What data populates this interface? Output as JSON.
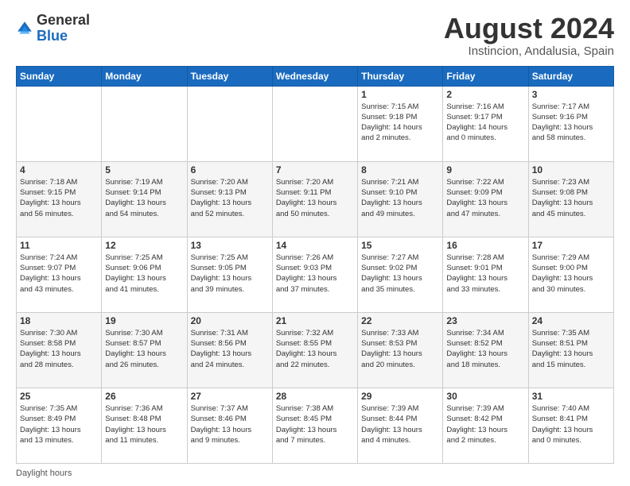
{
  "logo": {
    "general": "General",
    "blue": "Blue"
  },
  "header": {
    "title": "August 2024",
    "subtitle": "Instincion, Andalusia, Spain"
  },
  "footer": {
    "daylight_hours": "Daylight hours"
  },
  "days_of_week": [
    "Sunday",
    "Monday",
    "Tuesday",
    "Wednesday",
    "Thursday",
    "Friday",
    "Saturday"
  ],
  "weeks": [
    [
      {
        "day": "",
        "info": ""
      },
      {
        "day": "",
        "info": ""
      },
      {
        "day": "",
        "info": ""
      },
      {
        "day": "",
        "info": ""
      },
      {
        "day": "1",
        "info": "Sunrise: 7:15 AM\nSunset: 9:18 PM\nDaylight: 14 hours\nand 2 minutes."
      },
      {
        "day": "2",
        "info": "Sunrise: 7:16 AM\nSunset: 9:17 PM\nDaylight: 14 hours\nand 0 minutes."
      },
      {
        "day": "3",
        "info": "Sunrise: 7:17 AM\nSunset: 9:16 PM\nDaylight: 13 hours\nand 58 minutes."
      }
    ],
    [
      {
        "day": "4",
        "info": "Sunrise: 7:18 AM\nSunset: 9:15 PM\nDaylight: 13 hours\nand 56 minutes."
      },
      {
        "day": "5",
        "info": "Sunrise: 7:19 AM\nSunset: 9:14 PM\nDaylight: 13 hours\nand 54 minutes."
      },
      {
        "day": "6",
        "info": "Sunrise: 7:20 AM\nSunset: 9:13 PM\nDaylight: 13 hours\nand 52 minutes."
      },
      {
        "day": "7",
        "info": "Sunrise: 7:20 AM\nSunset: 9:11 PM\nDaylight: 13 hours\nand 50 minutes."
      },
      {
        "day": "8",
        "info": "Sunrise: 7:21 AM\nSunset: 9:10 PM\nDaylight: 13 hours\nand 49 minutes."
      },
      {
        "day": "9",
        "info": "Sunrise: 7:22 AM\nSunset: 9:09 PM\nDaylight: 13 hours\nand 47 minutes."
      },
      {
        "day": "10",
        "info": "Sunrise: 7:23 AM\nSunset: 9:08 PM\nDaylight: 13 hours\nand 45 minutes."
      }
    ],
    [
      {
        "day": "11",
        "info": "Sunrise: 7:24 AM\nSunset: 9:07 PM\nDaylight: 13 hours\nand 43 minutes."
      },
      {
        "day": "12",
        "info": "Sunrise: 7:25 AM\nSunset: 9:06 PM\nDaylight: 13 hours\nand 41 minutes."
      },
      {
        "day": "13",
        "info": "Sunrise: 7:25 AM\nSunset: 9:05 PM\nDaylight: 13 hours\nand 39 minutes."
      },
      {
        "day": "14",
        "info": "Sunrise: 7:26 AM\nSunset: 9:03 PM\nDaylight: 13 hours\nand 37 minutes."
      },
      {
        "day": "15",
        "info": "Sunrise: 7:27 AM\nSunset: 9:02 PM\nDaylight: 13 hours\nand 35 minutes."
      },
      {
        "day": "16",
        "info": "Sunrise: 7:28 AM\nSunset: 9:01 PM\nDaylight: 13 hours\nand 33 minutes."
      },
      {
        "day": "17",
        "info": "Sunrise: 7:29 AM\nSunset: 9:00 PM\nDaylight: 13 hours\nand 30 minutes."
      }
    ],
    [
      {
        "day": "18",
        "info": "Sunrise: 7:30 AM\nSunset: 8:58 PM\nDaylight: 13 hours\nand 28 minutes."
      },
      {
        "day": "19",
        "info": "Sunrise: 7:30 AM\nSunset: 8:57 PM\nDaylight: 13 hours\nand 26 minutes."
      },
      {
        "day": "20",
        "info": "Sunrise: 7:31 AM\nSunset: 8:56 PM\nDaylight: 13 hours\nand 24 minutes."
      },
      {
        "day": "21",
        "info": "Sunrise: 7:32 AM\nSunset: 8:55 PM\nDaylight: 13 hours\nand 22 minutes."
      },
      {
        "day": "22",
        "info": "Sunrise: 7:33 AM\nSunset: 8:53 PM\nDaylight: 13 hours\nand 20 minutes."
      },
      {
        "day": "23",
        "info": "Sunrise: 7:34 AM\nSunset: 8:52 PM\nDaylight: 13 hours\nand 18 minutes."
      },
      {
        "day": "24",
        "info": "Sunrise: 7:35 AM\nSunset: 8:51 PM\nDaylight: 13 hours\nand 15 minutes."
      }
    ],
    [
      {
        "day": "25",
        "info": "Sunrise: 7:35 AM\nSunset: 8:49 PM\nDaylight: 13 hours\nand 13 minutes."
      },
      {
        "day": "26",
        "info": "Sunrise: 7:36 AM\nSunset: 8:48 PM\nDaylight: 13 hours\nand 11 minutes."
      },
      {
        "day": "27",
        "info": "Sunrise: 7:37 AM\nSunset: 8:46 PM\nDaylight: 13 hours\nand 9 minutes."
      },
      {
        "day": "28",
        "info": "Sunrise: 7:38 AM\nSunset: 8:45 PM\nDaylight: 13 hours\nand 7 minutes."
      },
      {
        "day": "29",
        "info": "Sunrise: 7:39 AM\nSunset: 8:44 PM\nDaylight: 13 hours\nand 4 minutes."
      },
      {
        "day": "30",
        "info": "Sunrise: 7:39 AM\nSunset: 8:42 PM\nDaylight: 13 hours\nand 2 minutes."
      },
      {
        "day": "31",
        "info": "Sunrise: 7:40 AM\nSunset: 8:41 PM\nDaylight: 13 hours\nand 0 minutes."
      }
    ]
  ]
}
